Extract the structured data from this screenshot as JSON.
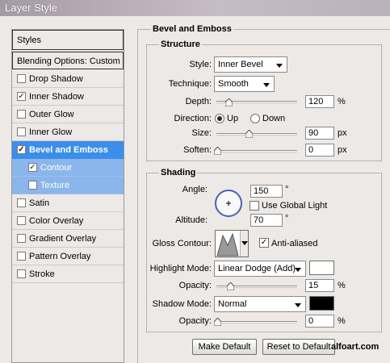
{
  "window": {
    "title": "Layer Style"
  },
  "sidebar": {
    "styles_label": "Styles",
    "blending_label": "Blending Options: Custom",
    "items": [
      {
        "label": "Drop Shadow",
        "checked": false
      },
      {
        "label": "Inner Shadow",
        "checked": true
      },
      {
        "label": "Outer Glow",
        "checked": false
      },
      {
        "label": "Inner Glow",
        "checked": false
      },
      {
        "label": "Bevel and Emboss",
        "checked": true,
        "selected": true
      },
      {
        "label": "Contour",
        "checked": true,
        "sub": true
      },
      {
        "label": "Texture",
        "checked": false,
        "sub": true
      },
      {
        "label": "Satin",
        "checked": false
      },
      {
        "label": "Color Overlay",
        "checked": false
      },
      {
        "label": "Gradient Overlay",
        "checked": false
      },
      {
        "label": "Pattern Overlay",
        "checked": false
      },
      {
        "label": "Stroke",
        "checked": false
      }
    ]
  },
  "bevel": {
    "title": "Bevel and Emboss",
    "structure": {
      "title": "Structure",
      "style_label": "Style:",
      "style_value": "Inner Bevel",
      "technique_label": "Technique:",
      "technique_value": "Smooth",
      "depth_label": "Depth:",
      "depth_value": "120",
      "depth_unit": "%",
      "direction_label": "Direction:",
      "direction_up": "Up",
      "direction_down": "Down",
      "size_label": "Size:",
      "size_value": "90",
      "size_unit": "px",
      "soften_label": "Soften:",
      "soften_value": "0",
      "soften_unit": "px"
    },
    "shading": {
      "title": "Shading",
      "angle_label": "Angle:",
      "angle_value": "150",
      "angle_unit": "°",
      "global_light_label": "Use Global Light",
      "altitude_label": "Altitude:",
      "altitude_value": "70",
      "altitude_unit": "°",
      "gloss_label": "Gloss Contour:",
      "anti_aliased_label": "Anti-aliased",
      "highlight_label": "Highlight Mode:",
      "highlight_value": "Linear Dodge (Add)",
      "highlight_color": "#ffffff",
      "highlight_opacity_label": "Opacity:",
      "highlight_opacity_value": "15",
      "highlight_opacity_unit": "%",
      "shadow_label": "Shadow Mode:",
      "shadow_value": "Normal",
      "shadow_color": "#000000",
      "shadow_opacity_label": "Opacity:",
      "shadow_opacity_value": "0",
      "shadow_opacity_unit": "%"
    },
    "buttons": {
      "make_default": "Make Default",
      "reset_default": "Reset to Default"
    }
  },
  "watermark": "alfoart.com",
  "colors": {
    "selected": "#3b8eea",
    "sub_selected": "#8ab6ec"
  }
}
